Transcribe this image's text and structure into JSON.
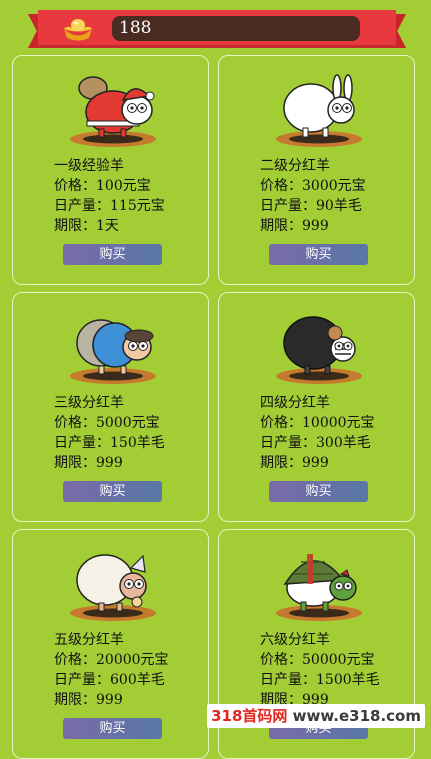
{
  "header": {
    "balance": "188",
    "icon": "gold-ingot-icon"
  },
  "products": [
    {
      "name": "一级经验羊",
      "price": "价格：100元宝",
      "yield": "日产量：115元宝",
      "term": "期限：1天",
      "buy": "购买",
      "image": "santa-sheep"
    },
    {
      "name": "二级分红羊",
      "price": "价格：3000元宝",
      "yield": "日产量：90羊毛",
      "term": "期限：999",
      "buy": "购买",
      "image": "bunny-sheep"
    },
    {
      "name": "三级分红羊",
      "price": "价格：5000元宝",
      "yield": "日产量：150羊毛",
      "term": "期限：999",
      "buy": "购买",
      "image": "blue-sheep"
    },
    {
      "name": "四级分红羊",
      "price": "价格：10000元宝",
      "yield": "日产量：300羊毛",
      "term": "期限：999",
      "buy": "购买",
      "image": "black-sheep"
    },
    {
      "name": "五级分红羊",
      "price": "价格：20000元宝",
      "yield": "日产量：600羊毛",
      "term": "期限：999",
      "buy": "购买",
      "image": "party-sheep"
    },
    {
      "name": "六级分红羊",
      "price": "价格：50000元宝",
      "yield": "日产量：1500羊毛",
      "term": "期限：999",
      "buy": "购买",
      "image": "turtle-sheep"
    }
  ],
  "watermark": {
    "brand": "318首码网",
    "url": "www.e318.com"
  }
}
